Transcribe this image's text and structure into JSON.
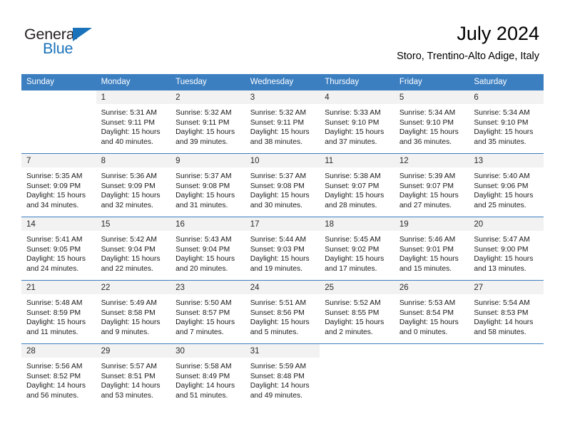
{
  "brand": {
    "name_part1": "General",
    "name_part2": "Blue",
    "triangle_icon": "triangle-icon",
    "accent_color": "#1a72ba"
  },
  "header": {
    "title": "July 2024",
    "subtitle": "Storo, Trentino-Alto Adige, Italy"
  },
  "calendar": {
    "header_bg": "#3c7fc1",
    "daynum_bg": "#f2f2f2",
    "weekday_headers": [
      "Sunday",
      "Monday",
      "Tuesday",
      "Wednesday",
      "Thursday",
      "Friday",
      "Saturday"
    ],
    "weeks": [
      [
        {
          "day": "",
          "lines": []
        },
        {
          "day": "1",
          "lines": [
            "Sunrise: 5:31 AM",
            "Sunset: 9:11 PM",
            "Daylight: 15 hours",
            "and 40 minutes."
          ]
        },
        {
          "day": "2",
          "lines": [
            "Sunrise: 5:32 AM",
            "Sunset: 9:11 PM",
            "Daylight: 15 hours",
            "and 39 minutes."
          ]
        },
        {
          "day": "3",
          "lines": [
            "Sunrise: 5:32 AM",
            "Sunset: 9:11 PM",
            "Daylight: 15 hours",
            "and 38 minutes."
          ]
        },
        {
          "day": "4",
          "lines": [
            "Sunrise: 5:33 AM",
            "Sunset: 9:10 PM",
            "Daylight: 15 hours",
            "and 37 minutes."
          ]
        },
        {
          "day": "5",
          "lines": [
            "Sunrise: 5:34 AM",
            "Sunset: 9:10 PM",
            "Daylight: 15 hours",
            "and 36 minutes."
          ]
        },
        {
          "day": "6",
          "lines": [
            "Sunrise: 5:34 AM",
            "Sunset: 9:10 PM",
            "Daylight: 15 hours",
            "and 35 minutes."
          ]
        }
      ],
      [
        {
          "day": "7",
          "lines": [
            "Sunrise: 5:35 AM",
            "Sunset: 9:09 PM",
            "Daylight: 15 hours",
            "and 34 minutes."
          ]
        },
        {
          "day": "8",
          "lines": [
            "Sunrise: 5:36 AM",
            "Sunset: 9:09 PM",
            "Daylight: 15 hours",
            "and 32 minutes."
          ]
        },
        {
          "day": "9",
          "lines": [
            "Sunrise: 5:37 AM",
            "Sunset: 9:08 PM",
            "Daylight: 15 hours",
            "and 31 minutes."
          ]
        },
        {
          "day": "10",
          "lines": [
            "Sunrise: 5:37 AM",
            "Sunset: 9:08 PM",
            "Daylight: 15 hours",
            "and 30 minutes."
          ]
        },
        {
          "day": "11",
          "lines": [
            "Sunrise: 5:38 AM",
            "Sunset: 9:07 PM",
            "Daylight: 15 hours",
            "and 28 minutes."
          ]
        },
        {
          "day": "12",
          "lines": [
            "Sunrise: 5:39 AM",
            "Sunset: 9:07 PM",
            "Daylight: 15 hours",
            "and 27 minutes."
          ]
        },
        {
          "day": "13",
          "lines": [
            "Sunrise: 5:40 AM",
            "Sunset: 9:06 PM",
            "Daylight: 15 hours",
            "and 25 minutes."
          ]
        }
      ],
      [
        {
          "day": "14",
          "lines": [
            "Sunrise: 5:41 AM",
            "Sunset: 9:05 PM",
            "Daylight: 15 hours",
            "and 24 minutes."
          ]
        },
        {
          "day": "15",
          "lines": [
            "Sunrise: 5:42 AM",
            "Sunset: 9:04 PM",
            "Daylight: 15 hours",
            "and 22 minutes."
          ]
        },
        {
          "day": "16",
          "lines": [
            "Sunrise: 5:43 AM",
            "Sunset: 9:04 PM",
            "Daylight: 15 hours",
            "and 20 minutes."
          ]
        },
        {
          "day": "17",
          "lines": [
            "Sunrise: 5:44 AM",
            "Sunset: 9:03 PM",
            "Daylight: 15 hours",
            "and 19 minutes."
          ]
        },
        {
          "day": "18",
          "lines": [
            "Sunrise: 5:45 AM",
            "Sunset: 9:02 PM",
            "Daylight: 15 hours",
            "and 17 minutes."
          ]
        },
        {
          "day": "19",
          "lines": [
            "Sunrise: 5:46 AM",
            "Sunset: 9:01 PM",
            "Daylight: 15 hours",
            "and 15 minutes."
          ]
        },
        {
          "day": "20",
          "lines": [
            "Sunrise: 5:47 AM",
            "Sunset: 9:00 PM",
            "Daylight: 15 hours",
            "and 13 minutes."
          ]
        }
      ],
      [
        {
          "day": "21",
          "lines": [
            "Sunrise: 5:48 AM",
            "Sunset: 8:59 PM",
            "Daylight: 15 hours",
            "and 11 minutes."
          ]
        },
        {
          "day": "22",
          "lines": [
            "Sunrise: 5:49 AM",
            "Sunset: 8:58 PM",
            "Daylight: 15 hours",
            "and 9 minutes."
          ]
        },
        {
          "day": "23",
          "lines": [
            "Sunrise: 5:50 AM",
            "Sunset: 8:57 PM",
            "Daylight: 15 hours",
            "and 7 minutes."
          ]
        },
        {
          "day": "24",
          "lines": [
            "Sunrise: 5:51 AM",
            "Sunset: 8:56 PM",
            "Daylight: 15 hours",
            "and 5 minutes."
          ]
        },
        {
          "day": "25",
          "lines": [
            "Sunrise: 5:52 AM",
            "Sunset: 8:55 PM",
            "Daylight: 15 hours",
            "and 2 minutes."
          ]
        },
        {
          "day": "26",
          "lines": [
            "Sunrise: 5:53 AM",
            "Sunset: 8:54 PM",
            "Daylight: 15 hours",
            "and 0 minutes."
          ]
        },
        {
          "day": "27",
          "lines": [
            "Sunrise: 5:54 AM",
            "Sunset: 8:53 PM",
            "Daylight: 14 hours",
            "and 58 minutes."
          ]
        }
      ],
      [
        {
          "day": "28",
          "lines": [
            "Sunrise: 5:56 AM",
            "Sunset: 8:52 PM",
            "Daylight: 14 hours",
            "and 56 minutes."
          ]
        },
        {
          "day": "29",
          "lines": [
            "Sunrise: 5:57 AM",
            "Sunset: 8:51 PM",
            "Daylight: 14 hours",
            "and 53 minutes."
          ]
        },
        {
          "day": "30",
          "lines": [
            "Sunrise: 5:58 AM",
            "Sunset: 8:49 PM",
            "Daylight: 14 hours",
            "and 51 minutes."
          ]
        },
        {
          "day": "31",
          "lines": [
            "Sunrise: 5:59 AM",
            "Sunset: 8:48 PM",
            "Daylight: 14 hours",
            "and 49 minutes."
          ]
        },
        {
          "day": "",
          "lines": []
        },
        {
          "day": "",
          "lines": []
        },
        {
          "day": "",
          "lines": []
        }
      ]
    ]
  }
}
